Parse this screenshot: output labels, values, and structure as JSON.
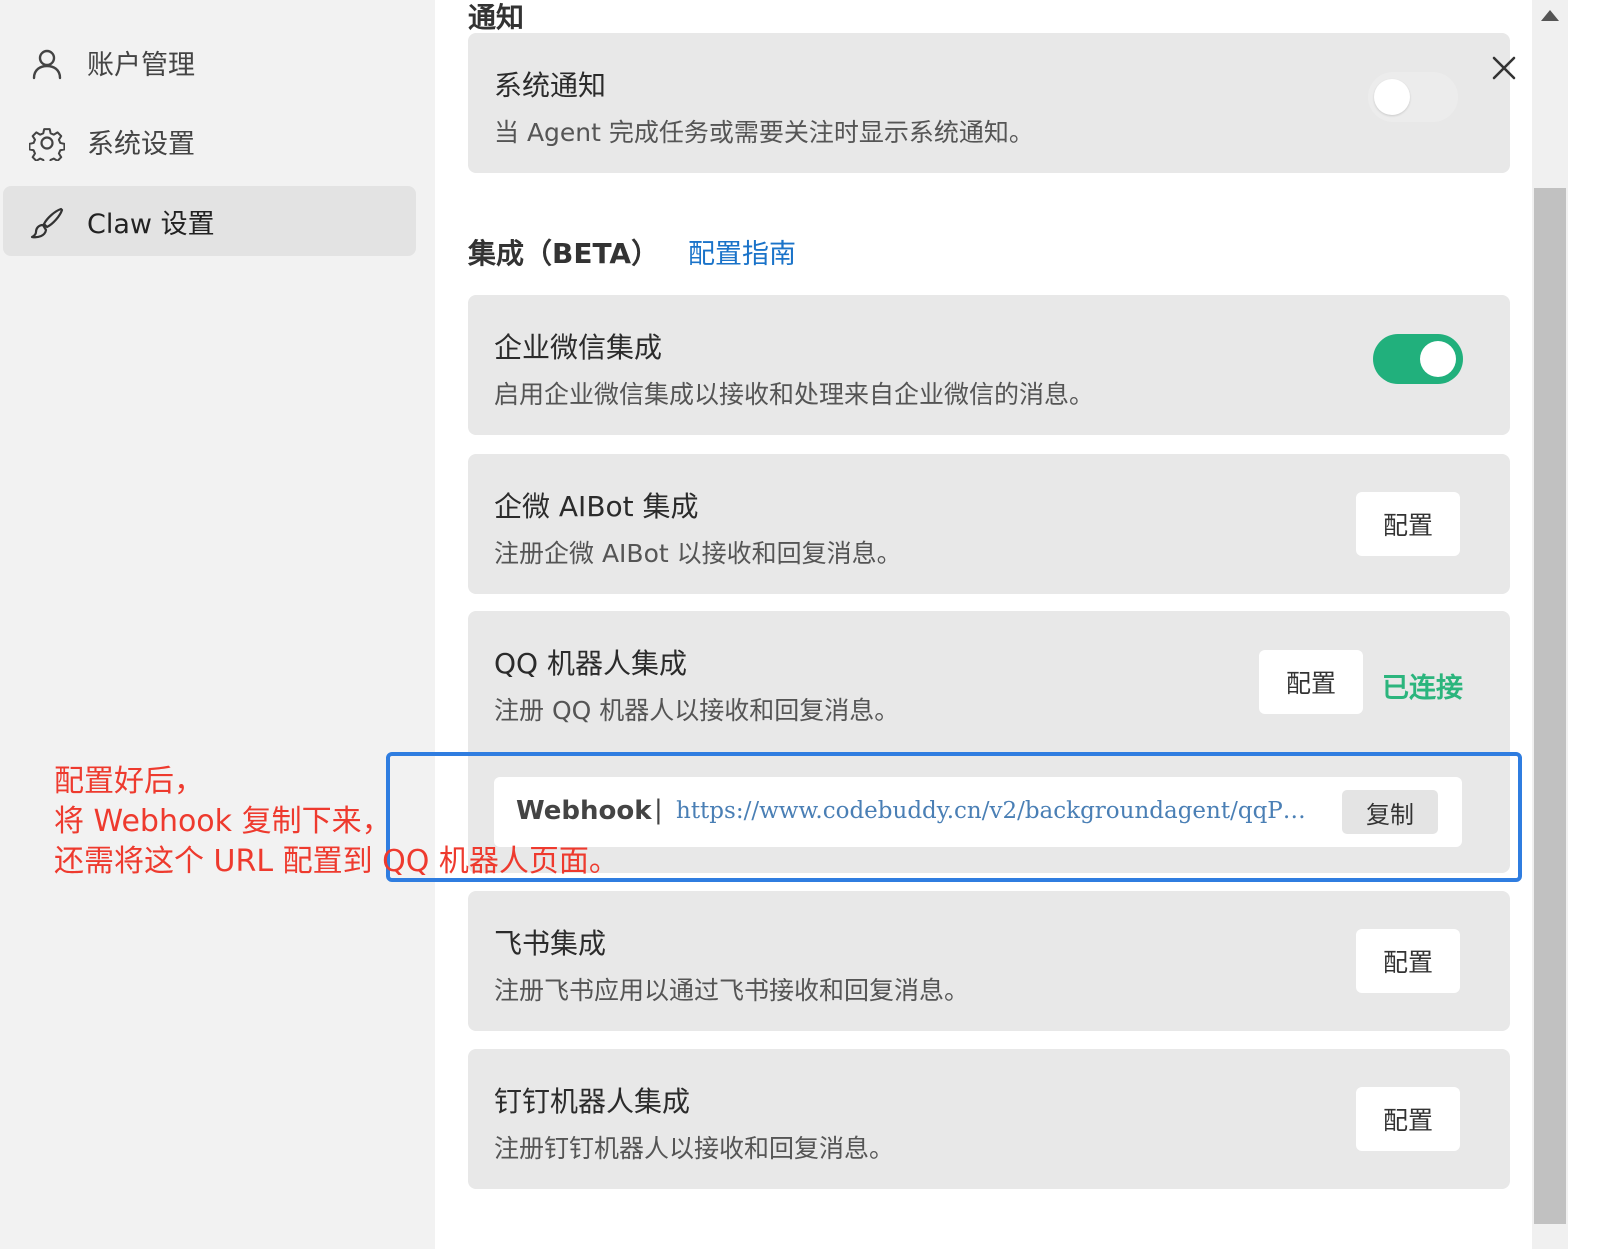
{
  "sidebar": {
    "items": [
      {
        "label": "账户管理",
        "icon": "user-icon"
      },
      {
        "label": "系统设置",
        "icon": "gear-icon"
      },
      {
        "label": "Claw 设置",
        "icon": "brush-icon",
        "active": true
      }
    ]
  },
  "notification": {
    "section_title": "通知",
    "system": {
      "title": "系统通知",
      "desc": "当 Agent 完成任务或需要关注时显示系统通知。",
      "enabled": false
    }
  },
  "integration": {
    "section_title": "集成（BETA）",
    "guide_link": "配置指南",
    "wecom": {
      "title": "企业微信集成",
      "desc": "启用企业微信集成以接收和处理来自企业微信的消息。",
      "enabled": true
    },
    "aibot": {
      "title": "企微 AIBot 集成",
      "desc": "注册企微 AIBot 以接收和回复消息。",
      "button": "配置"
    },
    "qq": {
      "title": "QQ 机器人集成",
      "desc": "注册 QQ 机器人以接收和回复消息。",
      "button": "配置",
      "status": "已连接",
      "webhook_label": "Webhook",
      "webhook_sep": "|",
      "webhook_url": "https://www.codebuddy.cn/v2/backgroundagent/qqP…",
      "copy_button": "复制"
    },
    "feishu": {
      "title": "飞书集成",
      "desc": "注册飞书应用以通过飞书接收和回复消息。",
      "button": "配置"
    },
    "dingtalk": {
      "title": "钉钉机器人集成",
      "desc": "注册钉钉机器人以接收和回复消息。",
      "button": "配置"
    }
  },
  "annotation": {
    "lines": [
      "配置好后，",
      "将 Webhook 复制下来，",
      "还需将这个 URL 配置到 QQ 机器人页面。"
    ]
  },
  "colors": {
    "accent": "#1a73c9",
    "toggle_on": "#21b07c",
    "connected": "#2bb57d",
    "annotation_text": "#ee3a2e",
    "annotation_box": "#2f7de0"
  }
}
